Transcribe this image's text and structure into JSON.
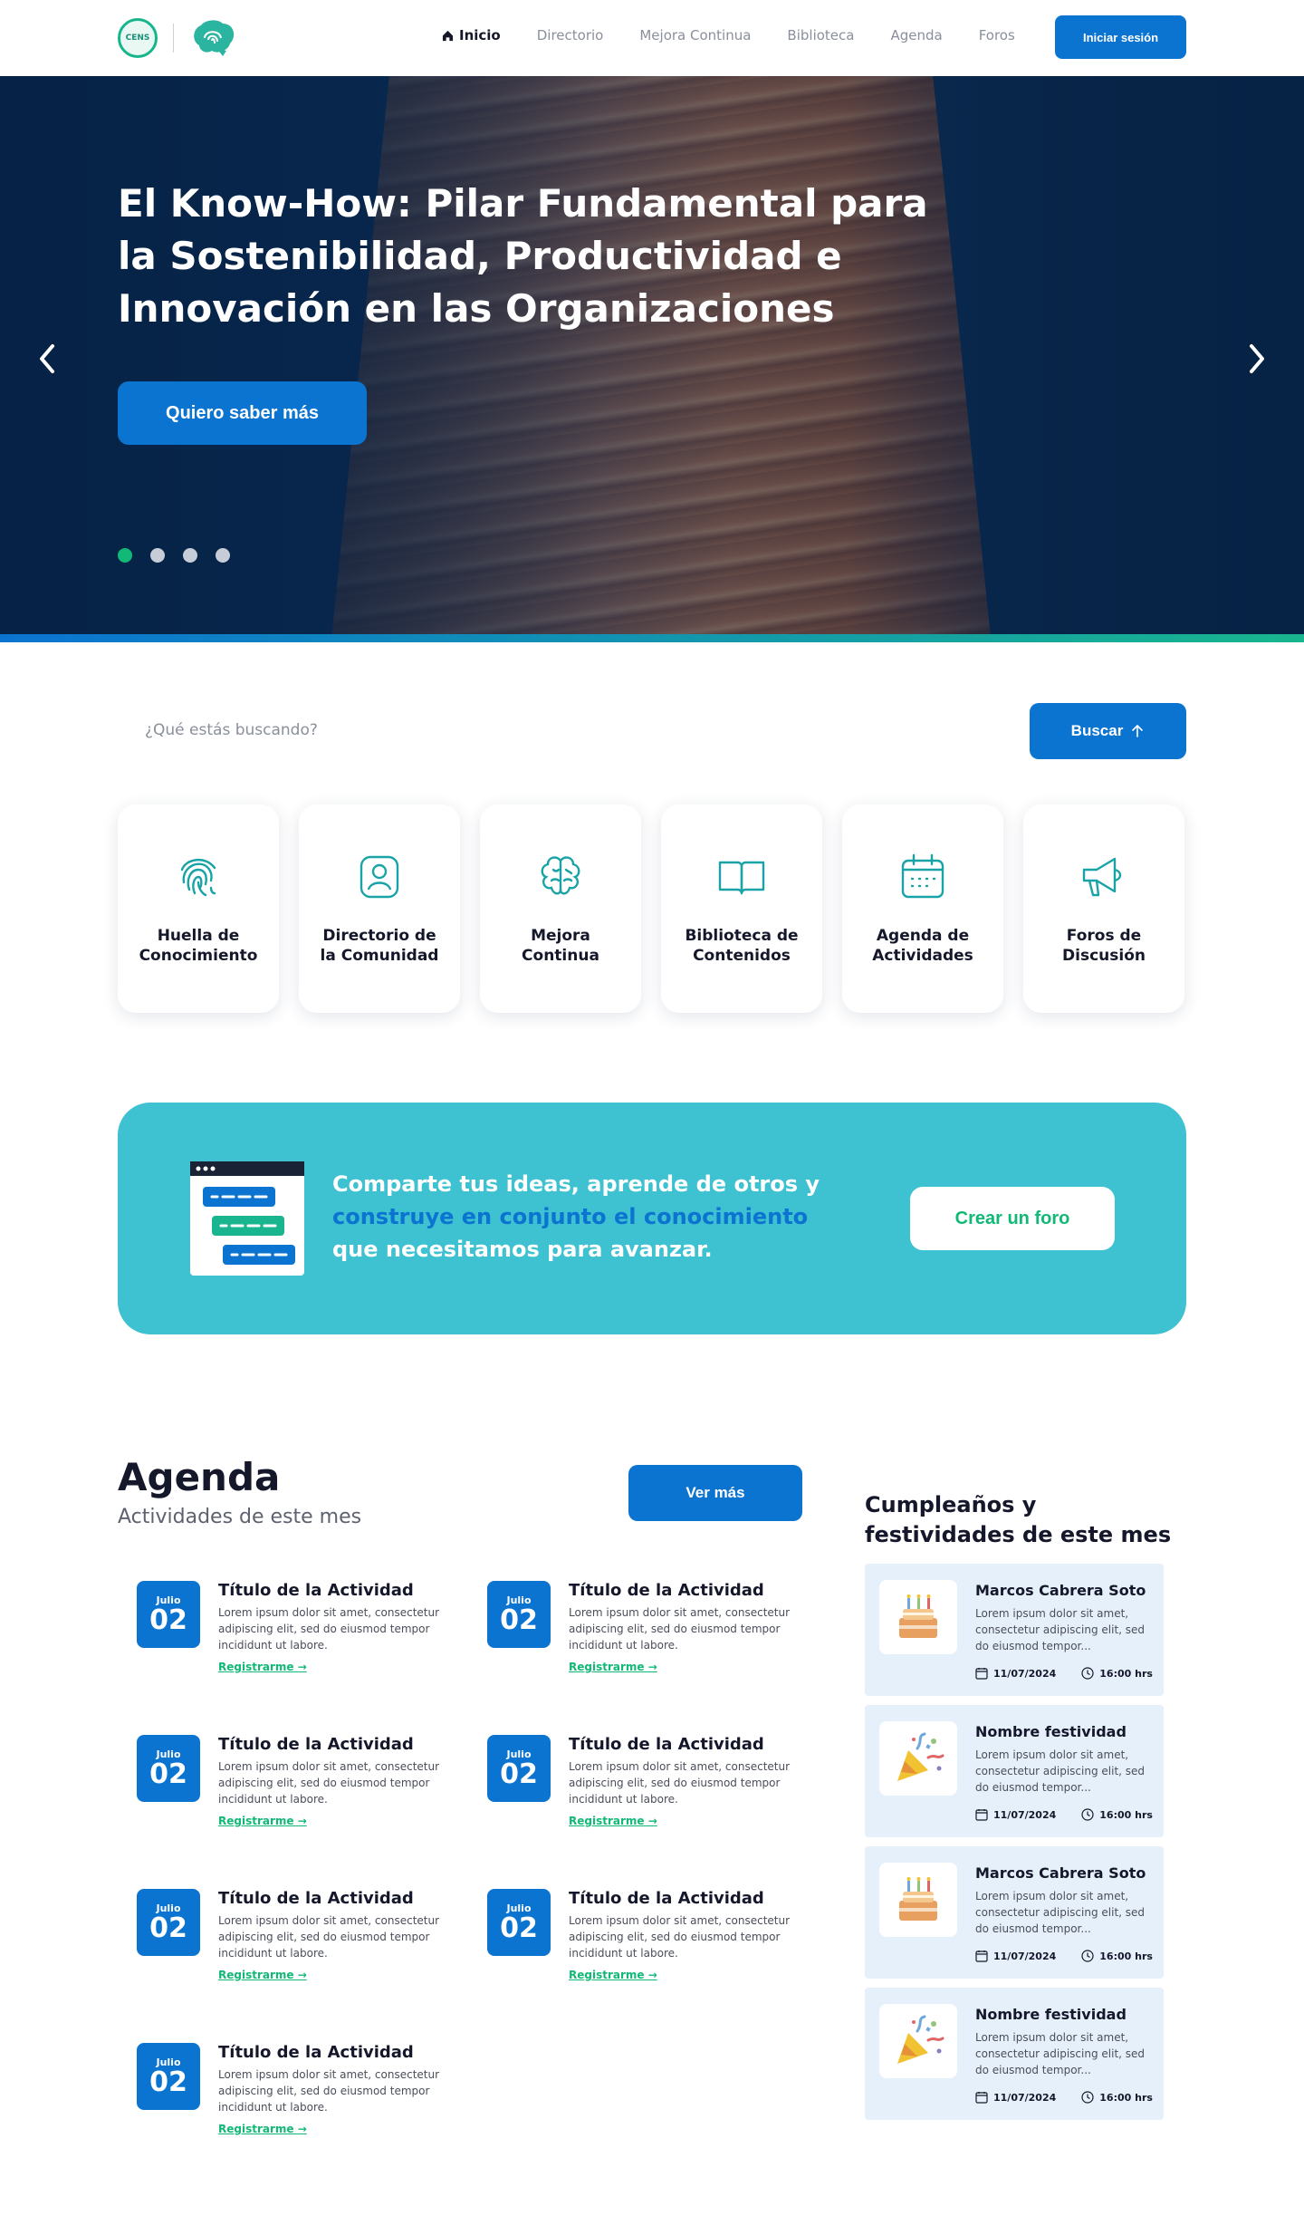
{
  "header": {
    "logo_text": "CENS",
    "nav": [
      "Inicio",
      "Directorio",
      "Mejora Continua",
      "Biblioteca",
      "Agenda",
      "Foros"
    ],
    "login_label": "Iniciar sesión"
  },
  "hero": {
    "title": "El Know-How: Pilar Fundamental para la Sostenibilidad, Productividad e Innovación en las Organizaciones",
    "cta_label": "Quiero saber más",
    "slide_count": 4,
    "active_slide": 1
  },
  "search": {
    "placeholder": "¿Qué estás buscando?",
    "button_label": "Buscar"
  },
  "quick_links": [
    {
      "label": "Huella de\nConocimiento",
      "icon": "fingerprint-icon"
    },
    {
      "label": "Directorio de\nla Comunidad",
      "icon": "user-icon"
    },
    {
      "label": "Mejora\nContinua",
      "icon": "brain-icon"
    },
    {
      "label": "Biblioteca de\nContenidos",
      "icon": "book-icon"
    },
    {
      "label": "Agenda de\nActividades",
      "icon": "calendar-icon"
    },
    {
      "label": "Foros de\nDiscusión",
      "icon": "megaphone-icon"
    }
  ],
  "banner": {
    "text_before": "Comparte tus ideas, aprende de otros y ",
    "text_highlight": "construye en conjunto el conocimiento",
    "text_after": " que necesitamos para avanzar.",
    "button_label": "Crear un foro"
  },
  "agenda": {
    "title": "Agenda",
    "subtitle": "Actividades de este mes",
    "more_label": "Ver más",
    "activities": [
      {
        "month": "Julio",
        "day": "02",
        "title": "Título de la Actividad",
        "desc": "Lorem ipsum dolor sit amet, consectetur adipiscing elit, sed do eiusmod tempor incididunt ut labore.",
        "link": "Registrarme →"
      },
      {
        "month": "Julio",
        "day": "02",
        "title": "Título de la Actividad",
        "desc": "Lorem ipsum dolor sit amet, consectetur adipiscing elit, sed do eiusmod tempor incididunt ut labore.",
        "link": "Registrarme →"
      },
      {
        "month": "Julio",
        "day": "02",
        "title": "Título de la Actividad",
        "desc": "Lorem ipsum dolor sit amet, consectetur adipiscing elit, sed do eiusmod tempor incididunt ut labore.",
        "link": "Registrarme →"
      },
      {
        "month": "Julio",
        "day": "02",
        "title": "Título de la Actividad",
        "desc": "Lorem ipsum dolor sit amet, consectetur adipiscing elit, sed do eiusmod tempor incididunt ut labore.",
        "link": "Registrarme →"
      },
      {
        "month": "Julio",
        "day": "02",
        "title": "Título de la Actividad",
        "desc": "Lorem ipsum dolor sit amet, consectetur adipiscing elit, sed do eiusmod tempor incididunt ut labore.",
        "link": "Registrarme →"
      },
      {
        "month": "Julio",
        "day": "02",
        "title": "Título de la Actividad",
        "desc": "Lorem ipsum dolor sit amet, consectetur adipiscing elit, sed do eiusmod tempor incididunt ut labore.",
        "link": "Registrarme →"
      },
      {
        "month": "Julio",
        "day": "02",
        "title": "Título de la Actividad",
        "desc": "Lorem ipsum dolor sit amet, consectetur adipiscing elit, sed do eiusmod tempor incididunt ut labore.",
        "link": "Registrarme →"
      }
    ]
  },
  "birthdays": {
    "title": "Cumpleaños y festividades de este mes",
    "items": [
      {
        "icon": "cake-icon",
        "name": "Marcos Cabrera Soto",
        "desc": "Lorem ipsum dolor sit amet, consectetur adipiscing elit, sed do eiusmod tempor...",
        "date": "11/07/2024",
        "time": "16:00 hrs"
      },
      {
        "icon": "party-popper-icon",
        "name": "Nombre festividad",
        "desc": "Lorem ipsum dolor sit amet, consectetur adipiscing elit, sed do eiusmod tempor...",
        "date": "11/07/2024",
        "time": "16:00 hrs"
      },
      {
        "icon": "cake-icon",
        "name": "Marcos Cabrera Soto",
        "desc": "Lorem ipsum dolor sit amet, consectetur adipiscing elit, sed do eiusmod tempor...",
        "date": "11/07/2024",
        "time": "16:00 hrs"
      },
      {
        "icon": "party-popper-icon",
        "name": "Nombre festividad",
        "desc": "Lorem ipsum dolor sit amet, consectetur adipiscing elit, sed do eiusmod tempor...",
        "date": "11/07/2024",
        "time": "16:00 hrs"
      }
    ]
  },
  "colors": {
    "primary": "#0b74d1",
    "accent_green": "#12b876",
    "banner_teal": "#3ec1d0",
    "hero_navy": "#0a2a4e",
    "card_bg_light": "#e6f0fb"
  }
}
